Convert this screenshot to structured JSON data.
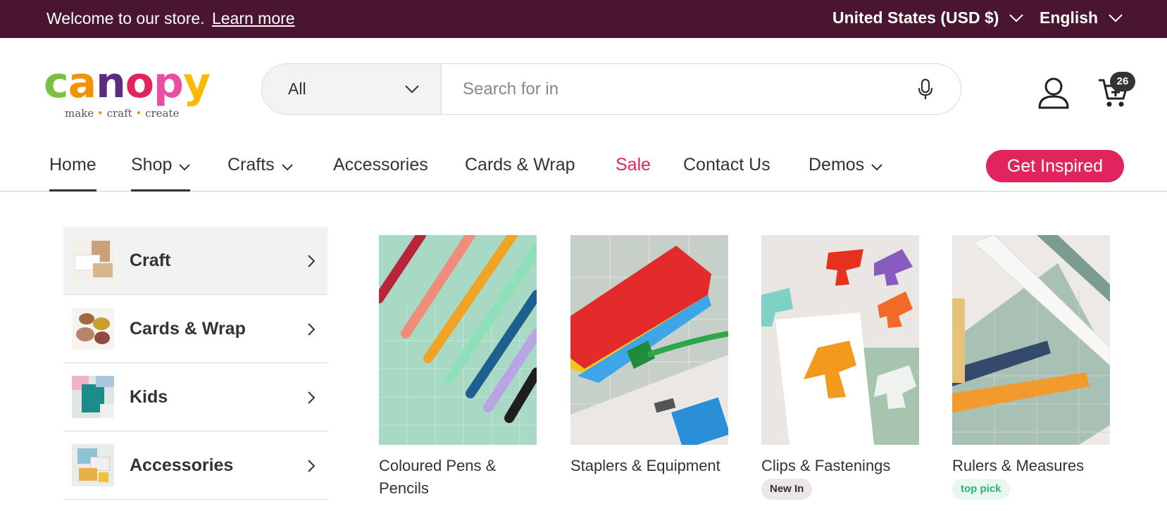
{
  "announcement": {
    "text": "Welcome to our store.",
    "link": "Learn more",
    "country": "United States (USD $)",
    "language": "English"
  },
  "logo": {
    "letters": [
      "c",
      "a",
      "n",
      "o",
      "p",
      "y"
    ],
    "tag_words": [
      "make",
      "craft",
      "create"
    ],
    "tag_sep": "•"
  },
  "search": {
    "category": "All",
    "placeholder": "Search for in"
  },
  "cart": {
    "count": "26"
  },
  "nav": {
    "home": "Home",
    "shop": "Shop",
    "crafts": "Crafts",
    "accessories": "Accessories",
    "cards_wrap": "Cards & Wrap",
    "sale": "Sale",
    "contact": "Contact Us",
    "demos": "Demos",
    "cta": "Get Inspired"
  },
  "sidebar": {
    "items": [
      {
        "label": "Craft"
      },
      {
        "label": "Cards & Wrap"
      },
      {
        "label": "Kids"
      },
      {
        "label": "Accessories"
      }
    ]
  },
  "products": [
    {
      "name": "Coloured Pens & Pencils"
    },
    {
      "name": "Staplers & Equipment"
    },
    {
      "name": "Clips & Fastenings",
      "badge": "New In"
    },
    {
      "name": "Rulers & Measures",
      "badge": "top pick"
    }
  ],
  "colors": {
    "topbar": "#4a1530",
    "accent": "#e0245e",
    "logo_letters": [
      "#7ac143",
      "#f39200",
      "#5a2d82",
      "#e0245e",
      "#e94ea1",
      "#fbb900"
    ]
  }
}
